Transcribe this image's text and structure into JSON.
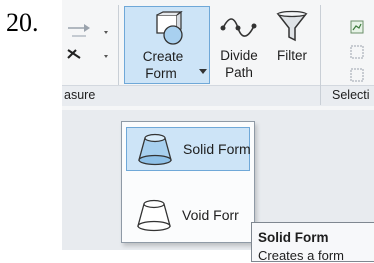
{
  "step_number": "20.",
  "ribbon": {
    "panels": {
      "measure_label": "asure",
      "selection_label": "Selecti"
    },
    "buttons": {
      "create_form": {
        "line1": "Create",
        "line2": "Form"
      },
      "divide_path": {
        "line1": "Divide",
        "line2": "Path"
      },
      "filter": {
        "label": "Filter"
      }
    }
  },
  "create_form_menu": {
    "items": [
      {
        "label": "Solid Form",
        "icon": "solid-form-icon"
      },
      {
        "label": "Void Forr",
        "icon": "void-form-icon"
      }
    ]
  },
  "tooltip": {
    "title": "Solid Form",
    "body": "Creates a form"
  },
  "colors": {
    "highlight": "#cde4f7",
    "highlight_border": "#6fa8d8",
    "solid_form_fill": "#a8d0ef"
  }
}
